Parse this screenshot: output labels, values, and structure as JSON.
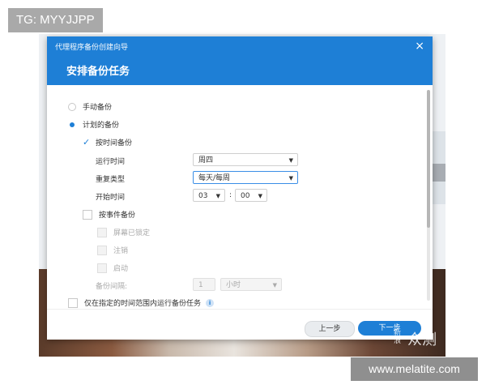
{
  "watermarks": {
    "tg": "TG: MYYJJPP",
    "site": "www.melatite.com",
    "sina": "新\n浪",
    "sina_big": "众测"
  },
  "dialog": {
    "window_title": "代理程序备份创建向导",
    "heading": "安排备份任务",
    "close": "×",
    "options": {
      "manual": "手动备份",
      "scheduled": "计划的备份",
      "by_time": "按时间备份",
      "run_time_label": "运行时间",
      "run_time_value": "周四",
      "repeat_label": "重复类型",
      "repeat_value": "每天/每周",
      "start_label": "开始时间",
      "start_hour": "03",
      "start_minute": "00",
      "colon": ":",
      "by_event": "按事件备份",
      "event_items": [
        "屏幕已锁定",
        "注销",
        "启动"
      ],
      "interval_label": "备份间隔:",
      "interval_value": "1",
      "interval_unit": "小时",
      "within_range": "仅在指定的时间范围内运行备份任务",
      "info": "i"
    },
    "footer": {
      "prev": "上一步",
      "next": "下一步"
    }
  },
  "colors": {
    "accent": "#1e7fd6"
  }
}
